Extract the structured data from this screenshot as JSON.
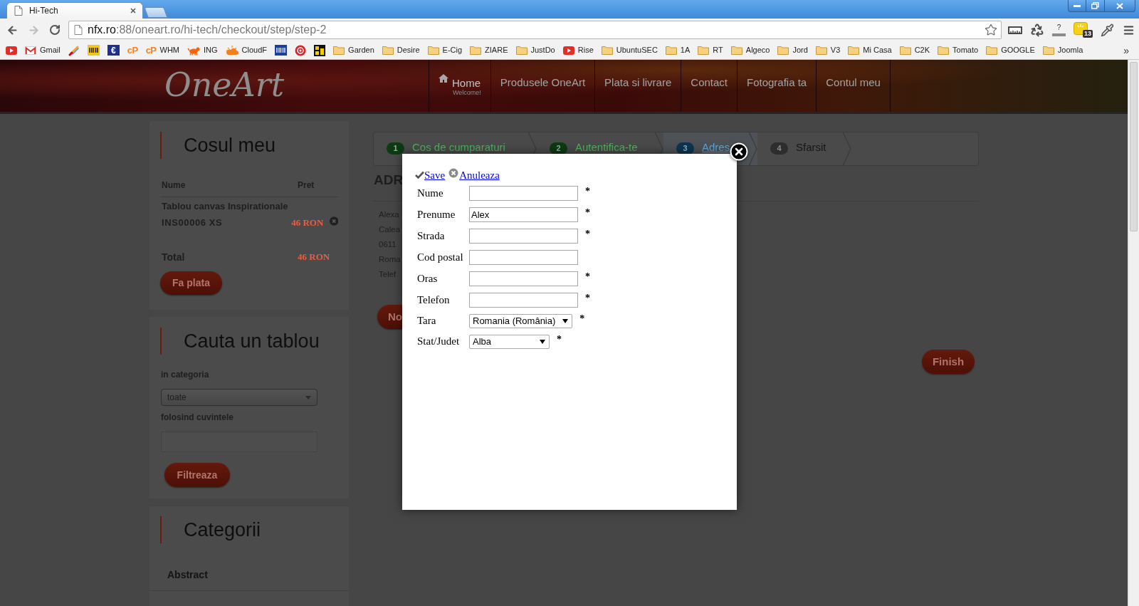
{
  "browser": {
    "tab": {
      "title": "Hi-Tech"
    },
    "nav_buttons": [
      {
        "kind": "back",
        "disabled": false
      },
      {
        "kind": "forward",
        "disabled": true
      },
      {
        "kind": "reload",
        "disabled": false
      }
    ],
    "address": {
      "host": "nfx.ro",
      "path": ":88/oneart.ro/hi-tech/checkout/step/step-2"
    },
    "extensions": [
      {
        "kind": "ruler"
      },
      {
        "kind": "recycle"
      },
      {
        "kind": "help",
        "glyph": "?"
      },
      {
        "kind": "notes",
        "badge": "13"
      },
      {
        "kind": "dropper"
      },
      {
        "kind": "menu"
      }
    ],
    "bookmarks": [
      {
        "kind": "play"
      },
      {
        "kind": "mail",
        "label": "Gmail"
      },
      {
        "kind": "brush"
      },
      {
        "kind": "tile",
        "color": "#f5c518"
      },
      {
        "kind": "tile",
        "badge": "€",
        "color": "#1f2f8a"
      },
      {
        "kind": "logo",
        "badge": "cP"
      },
      {
        "kind": "logo",
        "badge": "cP",
        "label": "WHM"
      },
      {
        "kind": "animal",
        "label": "ING"
      },
      {
        "kind": "cloud",
        "label": "CloudF"
      },
      {
        "kind": "tile",
        "color": "#1d3f97"
      },
      {
        "kind": "target"
      },
      {
        "kind": "emblem"
      },
      {
        "kind": "folder",
        "label": "Garden"
      },
      {
        "kind": "folder",
        "label": "Desire"
      },
      {
        "kind": "folder",
        "label": "E-Cig"
      },
      {
        "kind": "folder",
        "label": "ZIARE"
      },
      {
        "kind": "folder",
        "label": "JustDo"
      },
      {
        "kind": "play",
        "label": "Rise"
      },
      {
        "kind": "folder",
        "label": "UbuntuSEC"
      },
      {
        "kind": "folder",
        "label": "1A"
      },
      {
        "kind": "folder",
        "label": "RT"
      },
      {
        "kind": "folder",
        "label": "Algeco"
      },
      {
        "kind": "folder",
        "label": "Jord"
      },
      {
        "kind": "folder",
        "label": "V3"
      },
      {
        "kind": "folder",
        "label": "Mi Casa"
      },
      {
        "kind": "folder",
        "label": "C2K"
      },
      {
        "kind": "folder",
        "label": "Tomato"
      },
      {
        "kind": "folder",
        "label": "GOOGLE"
      },
      {
        "kind": "folder",
        "label": "Joomla"
      }
    ],
    "bookmarks_overflow": "»"
  },
  "site": {
    "logo": "OneArt",
    "nav": [
      {
        "kind": "home",
        "label": "Home",
        "subtitle": "Welcome!"
      },
      {
        "kind": "link",
        "label": "Produsele OneArt"
      },
      {
        "kind": "link",
        "label": "Plata si livrare"
      },
      {
        "kind": "link",
        "label": "Contact"
      },
      {
        "kind": "link",
        "label": "Fotografia ta"
      },
      {
        "kind": "link",
        "label": "Contul meu"
      }
    ]
  },
  "sidebar": {
    "cart": {
      "title": "Cosul meu",
      "columns": [
        "Nume",
        "Pret"
      ],
      "items": [
        {
          "name": "Tablou canvas Inspirationale",
          "code": "INS00006 XS",
          "price": "46 RON"
        }
      ],
      "total_label": "Total",
      "total": "46 RON",
      "button": "Fa plata"
    },
    "search": {
      "title": "Cauta un tablou",
      "category_label": "in categoria",
      "category": "toate",
      "keywords_label": "folosind cuvintele",
      "button": "Filtreaza"
    },
    "categories": {
      "title": "Categorii",
      "items": [
        "Abstract"
      ]
    }
  },
  "checkout": {
    "steps": [
      {
        "number": "1",
        "label": "Cos de cumparaturi",
        "completed": true,
        "selected": false
      },
      {
        "number": "2",
        "label": "Autentifica-te",
        "completed": true,
        "selected": false
      },
      {
        "number": "3",
        "label": "Adres",
        "completed": false,
        "selected": true
      },
      {
        "number": "4",
        "label": "Sfarsit",
        "completed": false,
        "selected": false
      }
    ],
    "heading": "ADR",
    "address_lines": [
      "Alexa",
      "Calea",
      "0611",
      "Roma",
      "Telef"
    ],
    "partial_button": "No",
    "finish_button": "Finish"
  },
  "modal": {
    "actions": [
      {
        "kind": "save",
        "label": "Save"
      },
      {
        "kind": "cancel",
        "label": "Anuleaza"
      }
    ],
    "fields": [
      {
        "kind": "text",
        "label": "Nume",
        "required_mark": "*"
      },
      {
        "kind": "text",
        "label": "Prenume",
        "value": "Alex",
        "required_mark": "*"
      },
      {
        "kind": "text",
        "label": "Strada",
        "required_mark": "*"
      },
      {
        "kind": "text",
        "label": "Cod postal"
      },
      {
        "kind": "text",
        "label": "Oras",
        "required_mark": "*"
      },
      {
        "kind": "text",
        "label": "Telefon",
        "required_mark": "*"
      },
      {
        "kind": "select",
        "label": "Tara",
        "value": "Romania (România)",
        "required_mark": "*"
      },
      {
        "kind": "select",
        "label": "Stat/Judet",
        "value": "Alba",
        "required_mark": "*"
      }
    ]
  }
}
